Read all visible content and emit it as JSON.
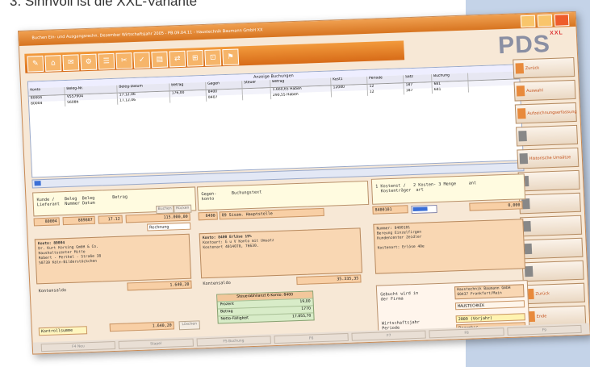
{
  "caption": "3.  Sinnvoll ist die XXL-Variante",
  "window": {
    "title": "Buchen Ein- und Ausgangsrechn. Dezember Wirtschaftsjahr 2005 - PB.09.04.11 - Haustechnik Baumann GmbH XX"
  },
  "logo": {
    "text": "PDS",
    "badge": "XXL"
  },
  "toolbar": [
    "✎",
    "⌂",
    "✉",
    "⚙",
    "☰",
    "✂",
    "✓",
    "▤",
    "⇄",
    "⊞",
    "⊡",
    "⚑"
  ],
  "grid": {
    "title": "Anzeige Buchungen",
    "columns": [
      "Konto",
      "Beleg-Nr.",
      "Beleg-Datum",
      "Betrag",
      "Gegen",
      "Steuer",
      "Betrag",
      "Kost1",
      "Periode",
      "Satz",
      "Buchung"
    ],
    "rows": [
      [
        "80004",
        "V557904",
        "17.12.06",
        "176,00",
        "8400",
        "",
        "1.660,65 Haben",
        "12040",
        "12",
        "187",
        "681"
      ],
      [
        "80004",
        "56086",
        "17.12.06",
        "",
        "8407",
        "",
        "290,55 Haben",
        "",
        "12",
        "187",
        "681"
      ]
    ]
  },
  "sidebar": [
    {
      "label": "Zurück",
      "style": "orange"
    },
    {
      "label": "Auswahl",
      "style": "orange"
    },
    {
      "label": "Aufzeichnungserfassung",
      "style": "orange"
    },
    {
      "label": "",
      "style": "gray"
    },
    {
      "label": "Historische Umsätze",
      "style": "gray"
    },
    {
      "label": "",
      "style": "gray"
    },
    {
      "label": "",
      "style": "gray"
    },
    {
      "label": "",
      "style": "gray"
    },
    {
      "label": "",
      "style": "gray"
    },
    {
      "label": "",
      "style": "gray"
    },
    {
      "label": "Zurück",
      "style": "orange"
    },
    {
      "label": "Ende",
      "style": "orange"
    }
  ],
  "entry": {
    "head_left": "Kunde /    Beleg  Beleg       Betrag\nLieferant  Nummer Datum",
    "head_mid": "Gegen-      Buchungstext\nkonto",
    "head_right": "1 Kostenst /   2 Kosten- 3 Menge     ant\n  Kostenträger  art",
    "konto": "80004",
    "beleg_nr": "889887",
    "beleg_datum": "17.12",
    "betrag": "115.000,00",
    "gegenkonto": "8400",
    "buchungstext": "89 Sisam. Hauptstelle",
    "kost1": "8400101",
    "kost_value": "0,000",
    "rechnung_label": "Rechnung",
    "mini1": "Buchen",
    "mini2": "Rücken"
  },
  "konto_box": {
    "title": "Konto: 80004",
    "text": "Dr. Kurt Korsing GmbH & Co.\nHaushaltscenter Mitte\nRobert - Perthel - Straße 38\n50739 Köln-Bilderstöckchen",
    "saldo_label": "Kontensaldo",
    "saldo": "1.640,20"
  },
  "gegen_box": {
    "title": "Konto: 8400 Erlöse 19%",
    "text": "Kontoart: G u V Konto mit Umsatz\nKostenart 4014070, 76630.",
    "saldo_label": "Kontensaldo",
    "saldo": "35.335,35"
  },
  "kost_box": {
    "text": "Nummer: 8400101\nBereung Einzelfirgen\nKundencenter Zeidler",
    "kostenart": "Kostenart: Erlöse 40e"
  },
  "tax_box": {
    "title": "Steuerabhilanzt 6 Konto: 8400",
    "rows": [
      {
        "k": "Prozent",
        "v": "19,00"
      },
      {
        "k": "Betrag",
        "v": "1770"
      },
      {
        "k": "Netto-Fälligkeit",
        "v": "17.855,70"
      }
    ]
  },
  "company_box": {
    "label": "Gebucht wird in\nder Firma",
    "value": "Haustechnik Baumann GmbH\n60437 Frankfurt/Main",
    "stnr": "MAUSTECHNIK",
    "wj_label": "Wirtschaftsjahr\nPeriode",
    "wj_value": "2009 (Vorjahr)",
    "periode_value": "Dezember"
  },
  "kontrollsumme": {
    "label": "Kontrollsumme",
    "value": "1.640,20",
    "btn": "Löschen"
  },
  "statusbar": [
    "F4 Neu",
    "Stapel",
    "F5 Buchung",
    "F6",
    "F7",
    "F8",
    "F9"
  ]
}
